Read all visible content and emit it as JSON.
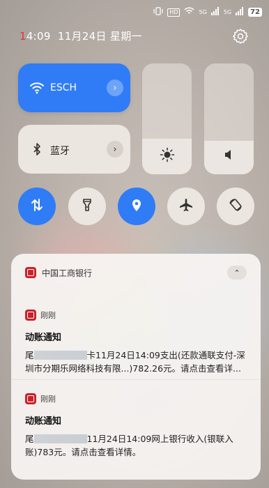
{
  "status_bar": {
    "hd": "HD",
    "net1": "5G",
    "net2": "5G",
    "battery": "72"
  },
  "time_bar": {
    "time_first": "1",
    "time_rest": "4:09",
    "date": "11月24日 星期一"
  },
  "quick_tiles": {
    "wifi": {
      "label": "ESCH",
      "active": true
    },
    "bluetooth": {
      "label": "蓝牙",
      "active": false
    },
    "brightness_level": 0.32,
    "volume_level": 0.3
  },
  "toggles": [
    {
      "name": "mobile-data",
      "active": true
    },
    {
      "name": "flashlight",
      "active": false
    },
    {
      "name": "location",
      "active": true
    },
    {
      "name": "airplane-mode",
      "active": false
    },
    {
      "name": "auto-rotate",
      "active": false
    }
  ],
  "notification_group": {
    "app_name": "中国工商银行",
    "items": [
      {
        "time": "刚刚",
        "title": "动账通知",
        "prefix": "尾",
        "masked_suffix": "卡",
        "body": "11月24日14:09支出(还款通联支付-深圳市分期乐网络科技有限...)782.26元。请点击查看详..."
      },
      {
        "time": "刚刚",
        "title": "动账通知",
        "prefix": "尾",
        "masked_suffix": "",
        "body": "11月24日14:09网上银行收入(银联入账)783元。请点击查看详情。"
      }
    ]
  },
  "colors": {
    "accent": "#2f7cf6",
    "bank_red": "#c8222a"
  }
}
